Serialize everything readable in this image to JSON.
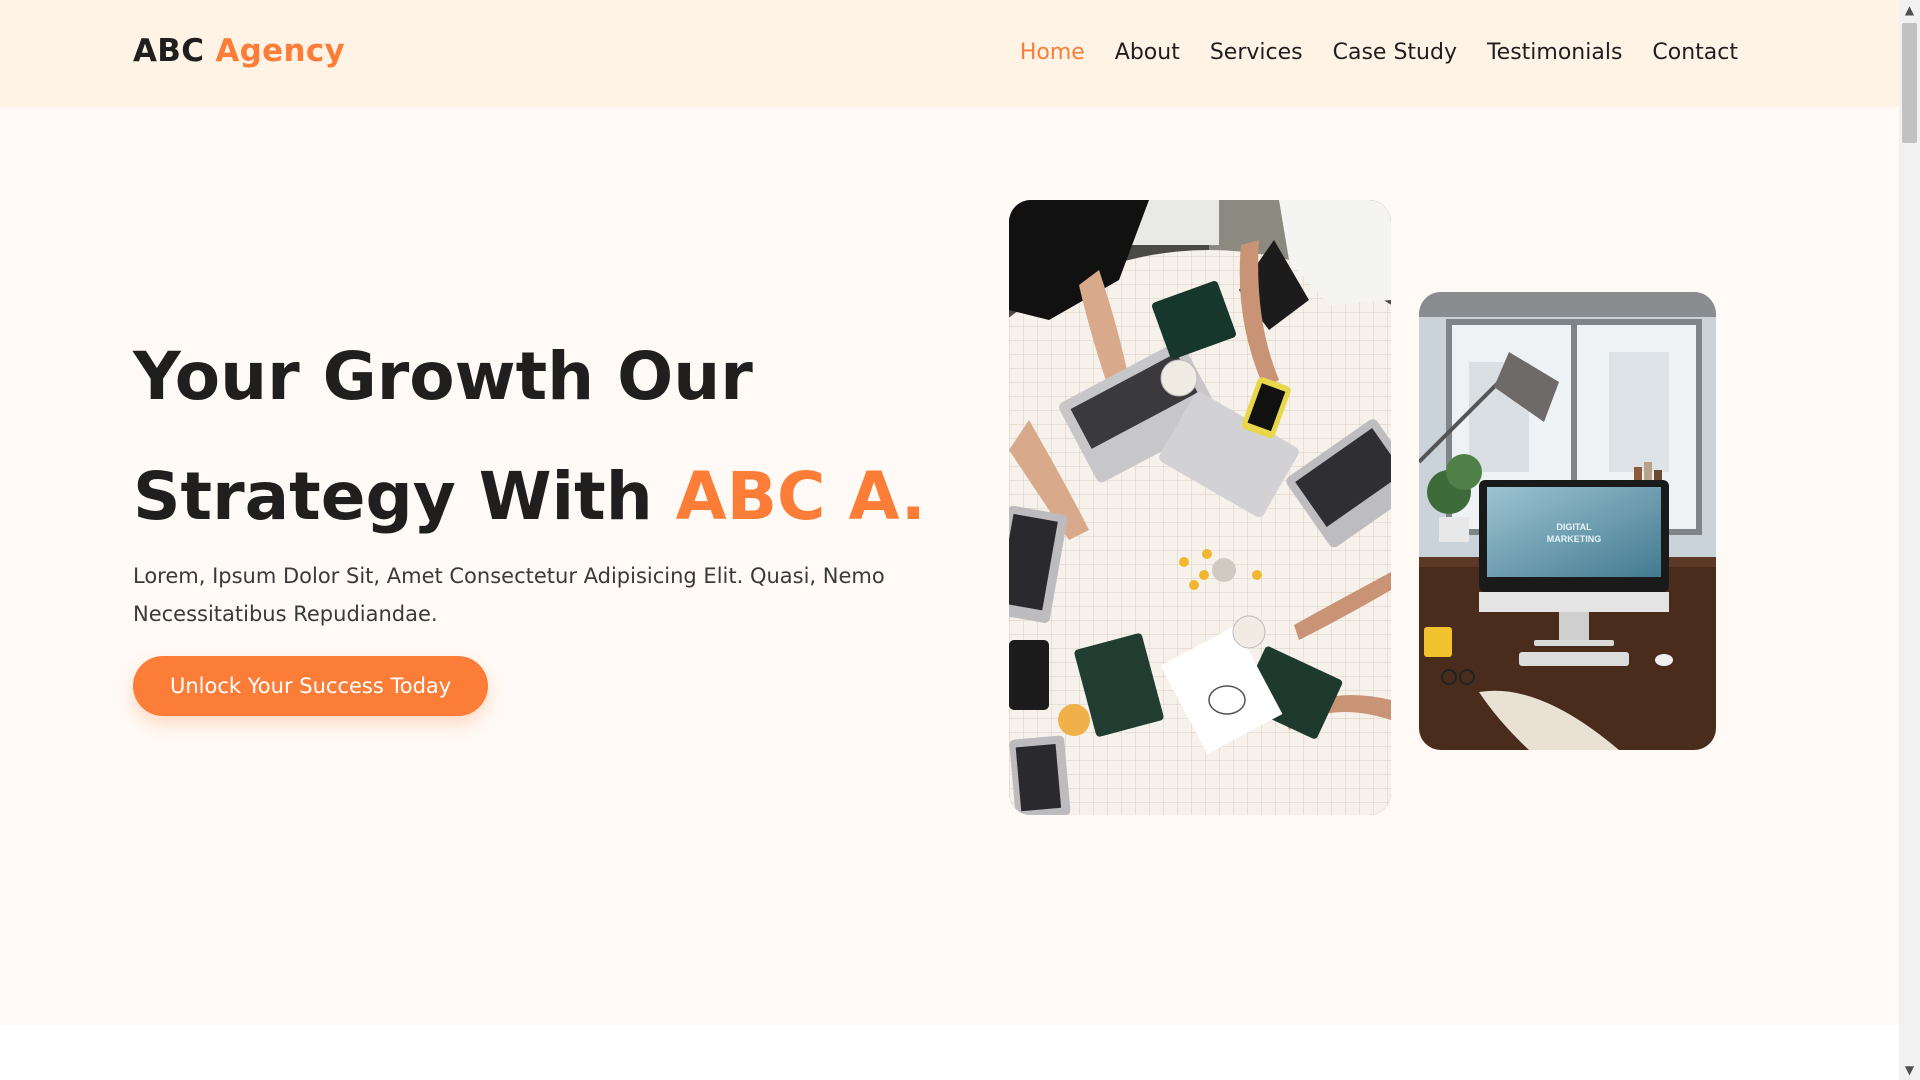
{
  "header": {
    "logo_main": "ABC",
    "logo_accent": "Agency",
    "nav": [
      {
        "label": "Home",
        "active": true
      },
      {
        "label": "About"
      },
      {
        "label": "Services"
      },
      {
        "label": "Case Study"
      },
      {
        "label": "Testimonials"
      },
      {
        "label": "Contact"
      }
    ]
  },
  "hero": {
    "title_line1": "Your Growth Our",
    "title_line2_prefix": "Strategy With",
    "title_line2_accent": "ABC A.",
    "description": "Lorem, Ipsum Dolor Sit, Amet Consectetur Adipisicing Elit. Quasi, Nemo Necessitatibus Repudiandae.",
    "cta_label": "Unlock Your Success Today"
  },
  "images": {
    "team_photo": "team-working-at-table-photo",
    "desk_photo": "desk-with-monitor-photo",
    "monitor_text_line1": "DIGITAL",
    "monitor_text_line2": "MARKETING"
  },
  "colors": {
    "accent": "#fb7d38",
    "header_bg": "#fff3e6",
    "hero_bg": "#fffaf5",
    "text": "#1f1f1f"
  }
}
